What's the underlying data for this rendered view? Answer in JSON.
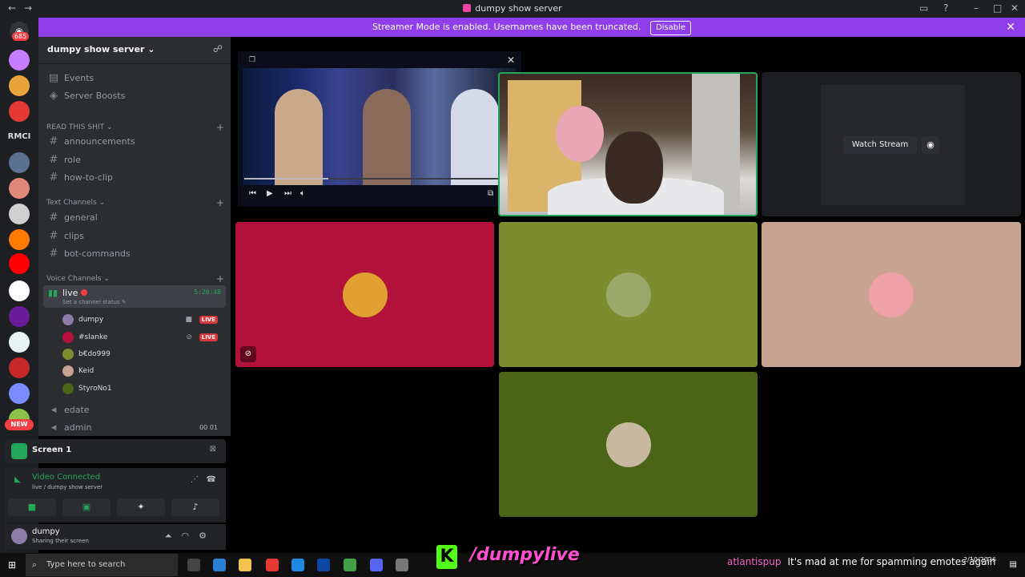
{
  "window": {
    "title": "dumpy show server"
  },
  "banner": {
    "text": "Streamer Mode is enabled. Usernames have been truncated.",
    "disable_label": "Disable"
  },
  "rail": {
    "home_badge": "685",
    "text_guild": "RMCI",
    "new_badge": "NEW"
  },
  "server": {
    "name": "dumpy show server"
  },
  "sidebar": {
    "events": "Events",
    "boosts": "Server Boosts",
    "categories": {
      "read": "READ THIS SHIT",
      "text": "Text Channels",
      "voice": "Voice Channels"
    },
    "read_channels": [
      "announcements",
      "role",
      "how-to-clip"
    ],
    "text_channels": [
      "general",
      "clips",
      "bot-commands"
    ],
    "voice": {
      "live_name": "live",
      "timer": "5:20:48",
      "status": "Set a channel status",
      "users": [
        {
          "name": "dumpy",
          "badge": "LIVE",
          "color": "#8b7ca8"
        },
        {
          "name": "#slanke",
          "badge": "LIVE",
          "color": "#b21139"
        },
        {
          "name": "b€do999",
          "badge": "",
          "color": "#7d8c2e"
        },
        {
          "name": "Keid",
          "badge": "",
          "color": "#c8a391"
        },
        {
          "name": "StyroNo1",
          "badge": "",
          "color": "#4b6516"
        }
      ],
      "other_channels": [
        "edate",
        "admin"
      ],
      "admin_counts": [
        "00",
        "01"
      ]
    }
  },
  "screen_panel": {
    "label": "Screen 1"
  },
  "rtc": {
    "status": "Video Connected",
    "channel": "live / dumpy show server"
  },
  "user": {
    "name": "dumpy",
    "status": "Sharing their screen"
  },
  "streams": {
    "watch_label": "Watch Stream"
  },
  "taskbar": {
    "search_placeholder": "Type here to search",
    "date": "2/10/2026"
  },
  "overlay": {
    "brand_letter": "K",
    "handle": "/dumpylive",
    "chat_user": "atlantispup",
    "chat_message": "It's mad at me for spamming emotes again"
  },
  "pip_video": {
    "progress": 0.31
  },
  "colors": {
    "accent_purple": "#8f3eea",
    "live_red": "#da373c",
    "speaking_green": "#23a55a",
    "tile_red": "#b21139",
    "tile_olive": "#7d8c2e",
    "tile_peach": "#c8a391",
    "tile_green": "#4b6516",
    "kick_green": "#53fc18"
  },
  "icons": [
    "back-arrow-icon",
    "forward-arrow-icon",
    "inbox-icon",
    "help-icon",
    "minimize-icon",
    "maximize-icon",
    "close-icon",
    "discord-home-icon",
    "add-member-icon",
    "calendar-icon",
    "boost-icon",
    "hash-icon",
    "speaker-icon",
    "camera-icon",
    "mute-icon",
    "screen-share-icon",
    "disconnect-icon",
    "noise-suppression-icon",
    "microphone-icon",
    "headphones-icon",
    "gear-icon",
    "popout-icon",
    "skip-back-icon",
    "play-icon",
    "skip-forward-icon",
    "volume-icon",
    "crop-icon",
    "fullscreen-icon",
    "windows-start-icon",
    "search-icon",
    "notification-icon"
  ]
}
